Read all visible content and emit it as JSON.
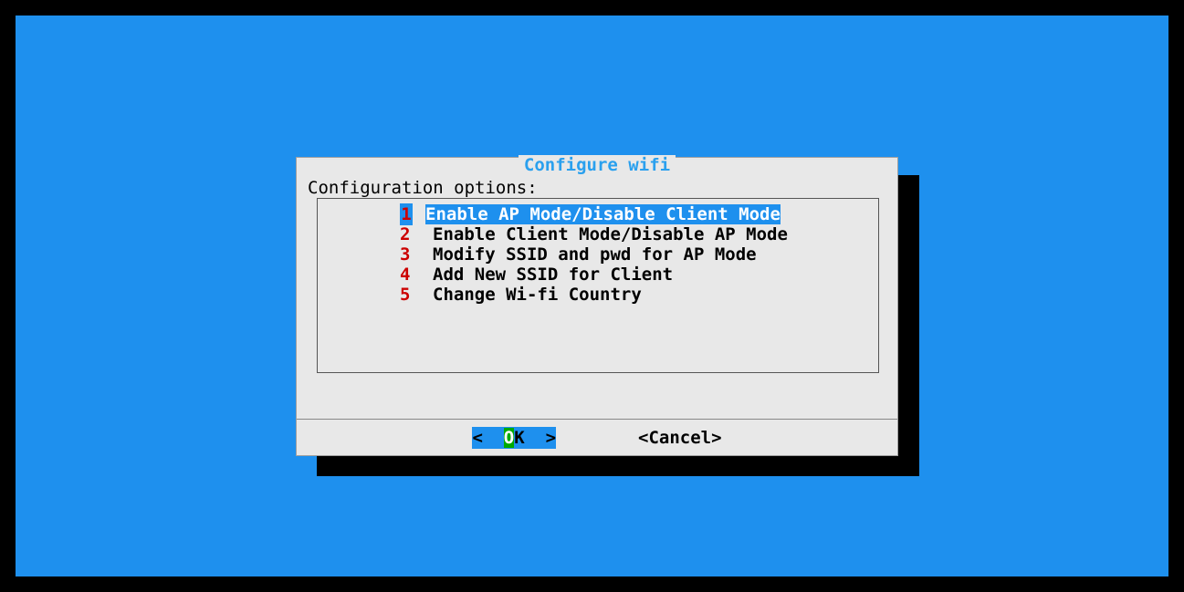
{
  "dialog": {
    "title": "Configure wifi",
    "prompt": "Configuration options:",
    "options": [
      {
        "num": "1",
        "label": "Enable AP Mode/Disable Client Mode",
        "selected": true
      },
      {
        "num": "2",
        "label": "Enable Client Mode/Disable AP Mode",
        "selected": false
      },
      {
        "num": "3",
        "label": "Modify SSID and pwd for AP Mode",
        "selected": false
      },
      {
        "num": "4",
        "label": "Add New SSID for Client",
        "selected": false
      },
      {
        "num": "5",
        "label": "Change Wi-fi Country",
        "selected": false
      }
    ],
    "buttons": {
      "ok": {
        "pre": "<  ",
        "hot": "O",
        "post": "K  >",
        "selected": true
      },
      "cancel": {
        "text": "<Cancel>",
        "selected": false
      }
    }
  }
}
